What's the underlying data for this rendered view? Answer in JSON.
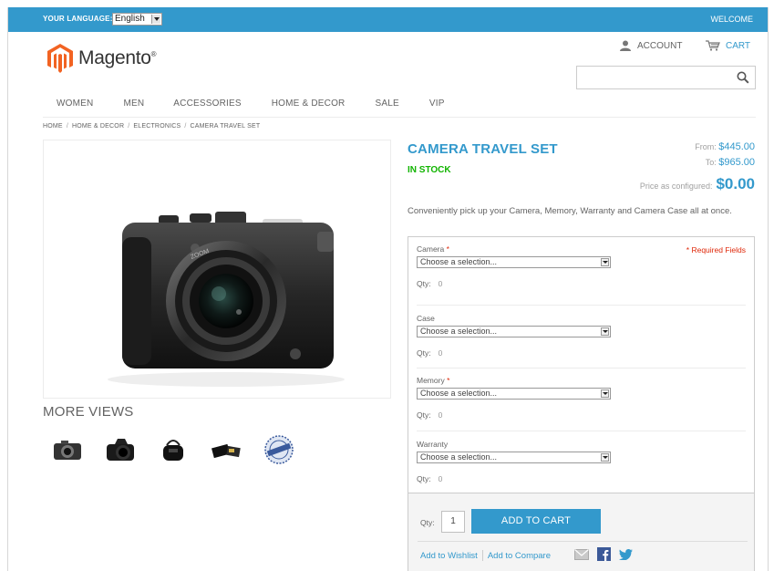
{
  "header": {
    "language_label": "YOUR LANGUAGE:",
    "language_value": "English",
    "welcome": "WELCOME",
    "brand": "Magento",
    "brand_mark": "®",
    "account": "ACCOUNT",
    "cart": "CART",
    "search_placeholder": ""
  },
  "nav": {
    "items": [
      "WOMEN",
      "MEN",
      "ACCESSORIES",
      "HOME & DECOR",
      "SALE",
      "VIP"
    ]
  },
  "breadcrumb": {
    "items": [
      "HOME",
      "HOME & DECOR",
      "ELECTRONICS",
      "CAMERA TRAVEL SET"
    ],
    "separator": "/"
  },
  "gallery": {
    "more_views": "MORE VIEWS",
    "thumbnails": [
      "camera-thumb-icon",
      "dslr-thumb-icon",
      "camera-case-thumb-icon",
      "memory-card-thumb-icon",
      "warranty-seal-thumb-icon"
    ]
  },
  "product": {
    "title": "CAMERA TRAVEL SET",
    "stock": "IN STOCK",
    "from_label": "From:",
    "from_price": "$445.00",
    "to_label": "To:",
    "to_price": "$965.00",
    "configured_label": "Price as configured:",
    "configured_price": "$0.00",
    "description": "Conveniently pick up your Camera, Memory, Warranty and Camera Case all at once."
  },
  "options": {
    "required_note": "* Required Fields",
    "qty_label": "Qty:",
    "items": [
      {
        "label": "Camera",
        "required": "*",
        "value": "Choose a selection...",
        "qty": "0"
      },
      {
        "label": "Case",
        "required": "",
        "value": "Choose a selection...",
        "qty": "0"
      },
      {
        "label": "Memory",
        "required": "*",
        "value": "Choose a selection...",
        "qty": "0"
      },
      {
        "label": "Warranty",
        "required": "",
        "value": "Choose a selection...",
        "qty": "0"
      }
    ]
  },
  "add_to_cart": {
    "qty_label": "Qty:",
    "qty_value": "1",
    "button": "ADD TO CART",
    "wishlist": "Add to Wishlist",
    "compare": "Add to Compare"
  },
  "colors": {
    "accent": "#3399cc",
    "in_stock": "#11b400",
    "required": "#df280a",
    "logo_orange": "#f26322"
  }
}
